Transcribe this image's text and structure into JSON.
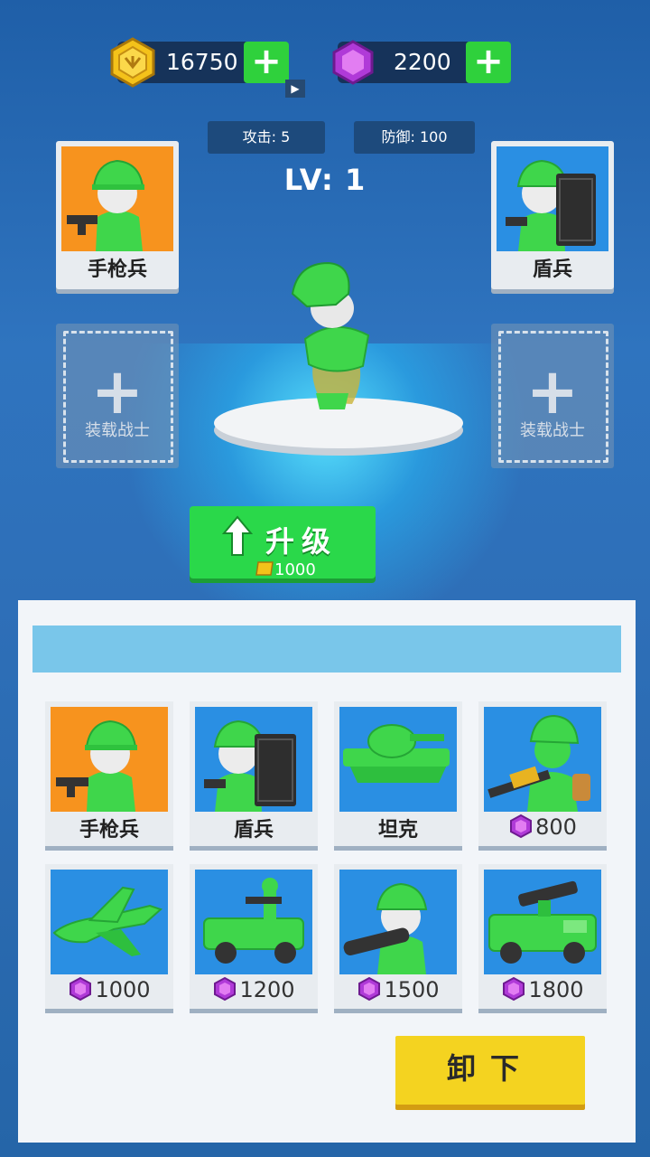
{
  "currency": {
    "coins": "16750",
    "gems": "2200",
    "plus_symbol": "+"
  },
  "stats": {
    "attack": "攻击: 5",
    "defense": "防御: 100"
  },
  "level": "LV: 1",
  "equipped": {
    "left": {
      "label": "手枪兵",
      "icon": "pistol-soldier"
    },
    "right": {
      "label": "盾兵",
      "icon": "shield-soldier"
    }
  },
  "empty_slot": {
    "plus": "+",
    "label": "装载战士"
  },
  "upgrade": {
    "label": "升级",
    "cost": "1000"
  },
  "units": [
    {
      "label": "手枪兵",
      "price": "",
      "icon": "pistol-soldier",
      "bg": "#f7931e"
    },
    {
      "label": "盾兵",
      "price": "",
      "icon": "shield-soldier",
      "bg": "#2a8fe3"
    },
    {
      "label": "坦克",
      "price": "",
      "icon": "tank",
      "bg": "#2a8fe3"
    },
    {
      "label": "",
      "price": "800",
      "icon": "rifle-soldier",
      "bg": "#2a8fe3"
    },
    {
      "label": "",
      "price": "1000",
      "icon": "jet",
      "bg": "#2a8fe3"
    },
    {
      "label": "",
      "price": "1200",
      "icon": "jeep",
      "bg": "#2a8fe3"
    },
    {
      "label": "",
      "price": "1500",
      "icon": "bazooka-soldier",
      "bg": "#2a8fe3"
    },
    {
      "label": "",
      "price": "1800",
      "icon": "rocket-truck",
      "bg": "#2a8fe3"
    }
  ],
  "unload": "卸下",
  "colors": {
    "accent_green": "#2ad84a",
    "gem_purple": "#b03ad8",
    "coin_gold": "#f4c21a",
    "button_yellow": "#f4d320"
  }
}
